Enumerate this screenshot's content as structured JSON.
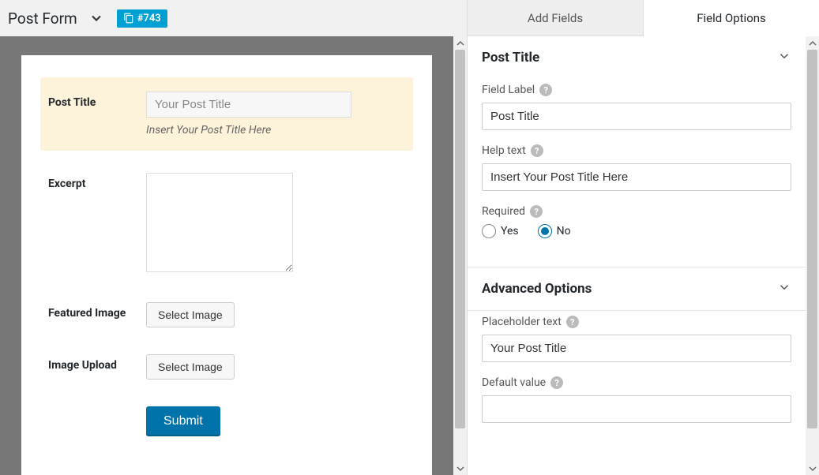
{
  "header": {
    "title": "Post Form",
    "badge": "#743"
  },
  "preview": {
    "fields": {
      "post_title": {
        "label": "Post Title",
        "placeholder": "Your Post Title",
        "help": "Insert Your Post Title Here"
      },
      "excerpt": {
        "label": "Excerpt"
      },
      "featured_image": {
        "label": "Featured Image",
        "button": "Select Image"
      },
      "image_upload": {
        "label": "Image Upload",
        "button": "Select Image"
      },
      "submit": {
        "label": "Submit"
      }
    }
  },
  "tabs": {
    "add_fields": "Add Fields",
    "field_options": "Field Options"
  },
  "options": {
    "section_title": "Post Title",
    "field_label": {
      "label": "Field Label",
      "value": "Post Title"
    },
    "help_text": {
      "label": "Help text",
      "value": "Insert Your Post Title Here"
    },
    "required": {
      "label": "Required",
      "yes": "Yes",
      "no": "No",
      "value": "No"
    },
    "advanced_title": "Advanced Options",
    "placeholder_text": {
      "label": "Placeholder text",
      "value": "Your Post Title"
    },
    "default_value": {
      "label": "Default value",
      "value": ""
    }
  }
}
